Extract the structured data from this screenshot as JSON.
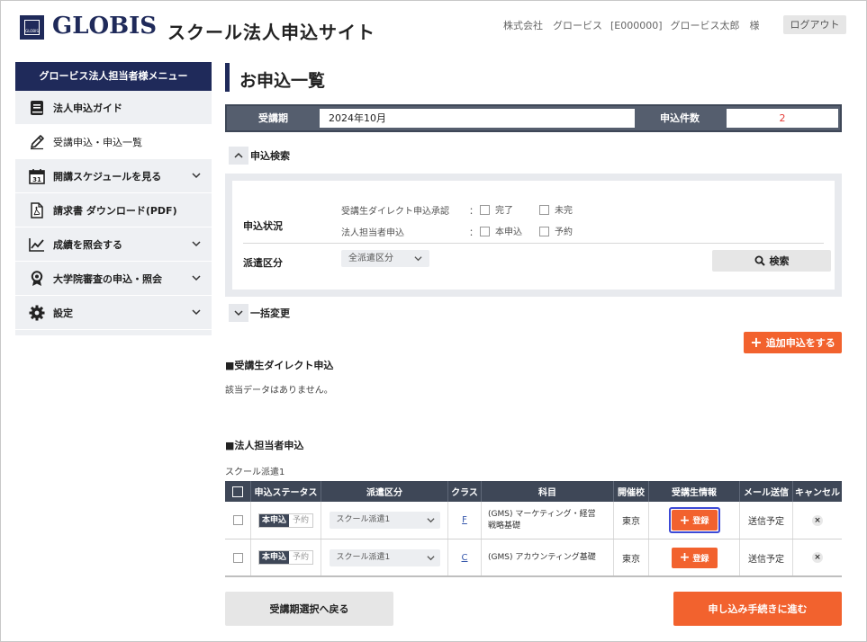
{
  "header": {
    "logo_box_text": "GLOBIS",
    "logo_text": "GLOBIS",
    "site_title": "スクール法人申込サイト",
    "company": "株式会社　グロービス",
    "company_code": "[E000000]",
    "user_name": "グロービス太郎　様",
    "logout_label": "ログアウト"
  },
  "sidebar": {
    "title": "グロービス法人担当者様メニュー",
    "items": [
      {
        "label": "法人申込ガイド",
        "icon": "book-icon",
        "active": false,
        "has_chevron": false
      },
      {
        "label": "受講申込・申込一覧",
        "icon": "pencil-icon",
        "active": true,
        "has_chevron": false
      },
      {
        "label": "開講スケジュールを見る",
        "icon": "calendar-icon",
        "active": false,
        "has_chevron": true
      },
      {
        "label": "請求書 ダウンロード(PDF)",
        "icon": "pdf-icon",
        "active": false,
        "has_chevron": false
      },
      {
        "label": "成績を照会する",
        "icon": "chart-line-icon",
        "active": false,
        "has_chevron": true
      },
      {
        "label": "大学院審査の申込・照会",
        "icon": "award-icon",
        "active": false,
        "has_chevron": true
      },
      {
        "label": "設定",
        "icon": "gear-icon",
        "active": false,
        "has_chevron": true
      }
    ]
  },
  "main": {
    "page_title": "お申込一覧",
    "period_label": "受講期",
    "period_value": "2024年10月",
    "count_label": "申込件数",
    "count_value": "2",
    "search_toggle_label": "申込検索",
    "search": {
      "status_label": "申込状況",
      "direct_label": "受講生ダイレクト申込承認",
      "direct_options": [
        "完了",
        "未完"
      ],
      "corp_label": "法人担当者申込",
      "corp_options": [
        "本申込",
        "予約"
      ],
      "colon": "：",
      "dispatch_label": "派遣区分",
      "dispatch_select": "全派遣区分",
      "search_button": "検索"
    },
    "bulk_toggle_label": "一括変更",
    "add_button": "追加申込をする",
    "direct_section_title": "■受講生ダイレクト申込",
    "no_data_text": "該当データはありません。",
    "corp_section_title": "■法人担当者申込",
    "group_label": "スクール派遣1",
    "table": {
      "headers": [
        "",
        "申込ステータス",
        "派遣区分",
        "クラス",
        "科目",
        "開催校",
        "受講生情報",
        "メール送信",
        "キャンセル"
      ],
      "rows": [
        {
          "status_on": "本申込",
          "status_off": "予約",
          "dispatch": "スクール派遣1",
          "class": "F",
          "subject_line1": "(GMS) マーケティング・経営",
          "subject_line2": "戦略基礎",
          "school": "東京",
          "register": "登録",
          "mail": "送信予定"
        },
        {
          "status_on": "本申込",
          "status_off": "予約",
          "dispatch": "スクール派遣1",
          "class": "C",
          "subject_line1": "(GMS) アカウンティング基礎",
          "subject_line2": "",
          "school": "東京",
          "register": "登録",
          "mail": "送信予定"
        }
      ]
    },
    "back_button": "受講期選択へ戻る",
    "proceed_button": "申し込み手続きに進む"
  },
  "colors": {
    "navy": "#1f2a5a",
    "table_header": "#3e4757",
    "accent_orange": "#f2622e",
    "count_red": "#e53935",
    "focus_blue": "#3d4ad6"
  }
}
